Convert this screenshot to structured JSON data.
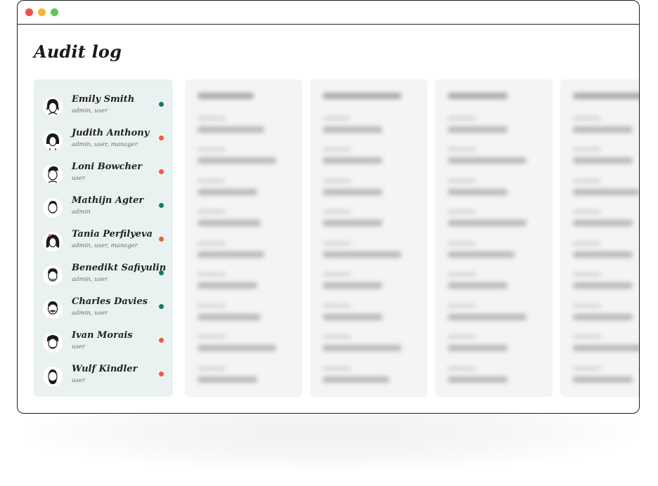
{
  "colors": {
    "window_red": "#f04e4e",
    "window_yellow": "#f4b63a",
    "window_green": "#5ec85a",
    "active": "#137a6b",
    "inactive": "#ee5a3f",
    "panel_bg": "#eaf2f1",
    "log_bg": "#f4f4f4"
  },
  "page": {
    "title": "Audit log"
  },
  "users": [
    {
      "name": "Emily Smith",
      "roles": "admin, user",
      "status": "active",
      "avatar": "woman-bun-avatar-icon"
    },
    {
      "name": "Judith Anthony",
      "roles": "admin, user, manager",
      "status": "inactive",
      "avatar": "woman-bob-avatar-icon"
    },
    {
      "name": "Loni Bowcher",
      "roles": "user",
      "status": "inactive",
      "avatar": "man-quiff-avatar-icon"
    },
    {
      "name": "Mathijn Agter",
      "roles": "admin",
      "status": "active",
      "avatar": "man-beard-avatar-icon"
    },
    {
      "name": "Tania Perfilyeva",
      "roles": "admin, user, manager",
      "status": "inactive",
      "avatar": "woman-long-hair-avatar-icon"
    },
    {
      "name": "Benedikt Safiyulin",
      "roles": "admin, user",
      "status": "active",
      "avatar": "man-avatar-icon"
    },
    {
      "name": "Charles Davies",
      "roles": "admin, user",
      "status": "active",
      "avatar": "man-mustache-avatar-icon"
    },
    {
      "name": "Ivan Morais",
      "roles": "user",
      "status": "inactive",
      "avatar": "man-curly-avatar-icon"
    },
    {
      "name": "Wulf Kindler",
      "roles": "user",
      "status": "inactive",
      "avatar": "man-full-beard-avatar-icon"
    }
  ]
}
